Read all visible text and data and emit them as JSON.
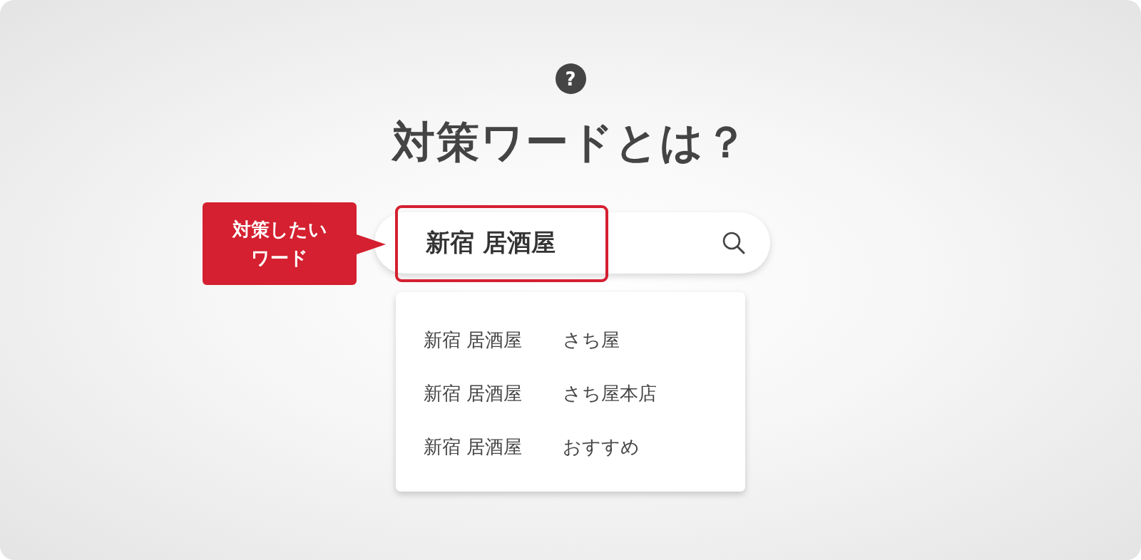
{
  "help_icon": {
    "glyph": "?"
  },
  "title": "対策ワードとは？",
  "callout": {
    "lines": [
      "対策したい",
      "ワード"
    ]
  },
  "search": {
    "value": "新宿 居酒屋",
    "highlighted": true
  },
  "suggestions": [
    {
      "query": "新宿 居酒屋",
      "suffix": "さち屋"
    },
    {
      "query": "新宿 居酒屋",
      "suffix": "さち屋本店"
    },
    {
      "query": "新宿 居酒屋",
      "suffix": "おすすめ"
    }
  ]
}
